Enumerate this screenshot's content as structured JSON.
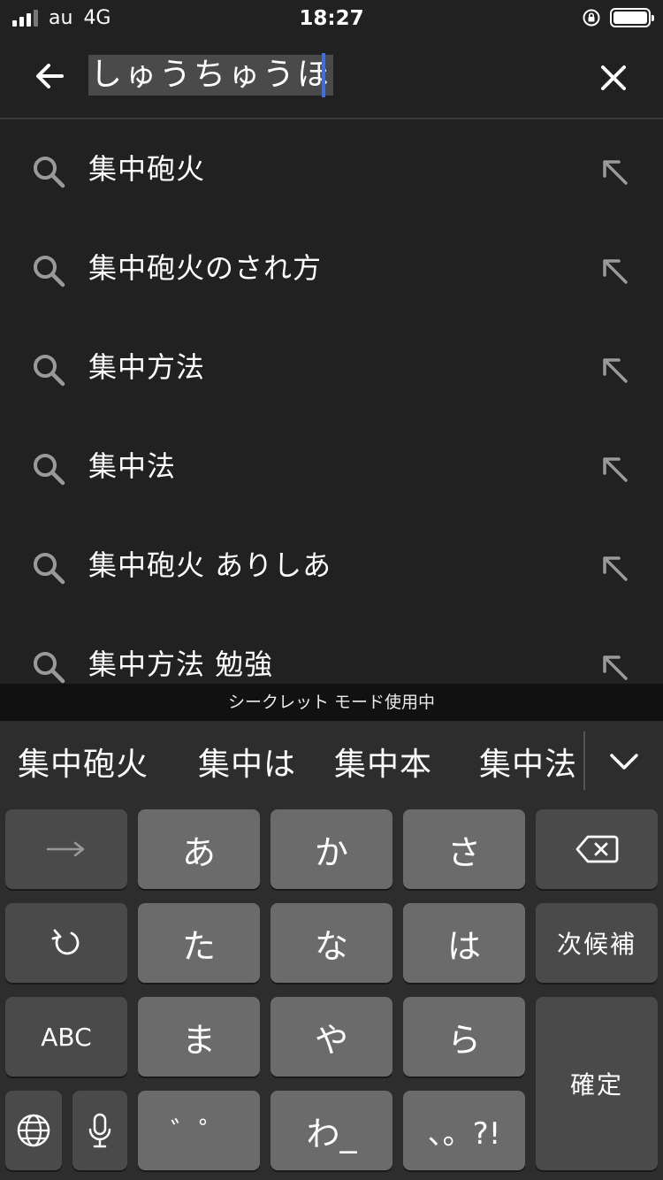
{
  "status_bar": {
    "carrier": "au",
    "network": "4G",
    "time": "18:27"
  },
  "search": {
    "query": "しゅうちゅうほ"
  },
  "suggestions": [
    {
      "text": "集中砲火"
    },
    {
      "text": "集中砲火のされ方"
    },
    {
      "text": "集中方法"
    },
    {
      "text": "集中法"
    },
    {
      "text": "集中砲火 ありしあ"
    },
    {
      "text": "集中方法 勉強"
    }
  ],
  "incognito_banner": "シークレット モード使用中",
  "keyboard": {
    "candidates": [
      "集中砲火",
      "集中は",
      "集中本",
      "集中法"
    ],
    "keys": {
      "a": "あ",
      "ka": "か",
      "sa": "さ",
      "ta": "た",
      "na": "な",
      "ha": "は",
      "ma": "ま",
      "ya": "や",
      "ra": "ら",
      "dakuten": "゛゜",
      "wa": "わ_",
      "punct": "、。?!",
      "next_candidate": "次候補",
      "abc": "ABC",
      "confirm": "確定"
    },
    "icons": {
      "arrow_right": "arrow-right-icon",
      "backspace": "backspace-icon",
      "undo": "undo-icon",
      "globe": "globe-icon",
      "mic": "microphone-icon"
    }
  }
}
